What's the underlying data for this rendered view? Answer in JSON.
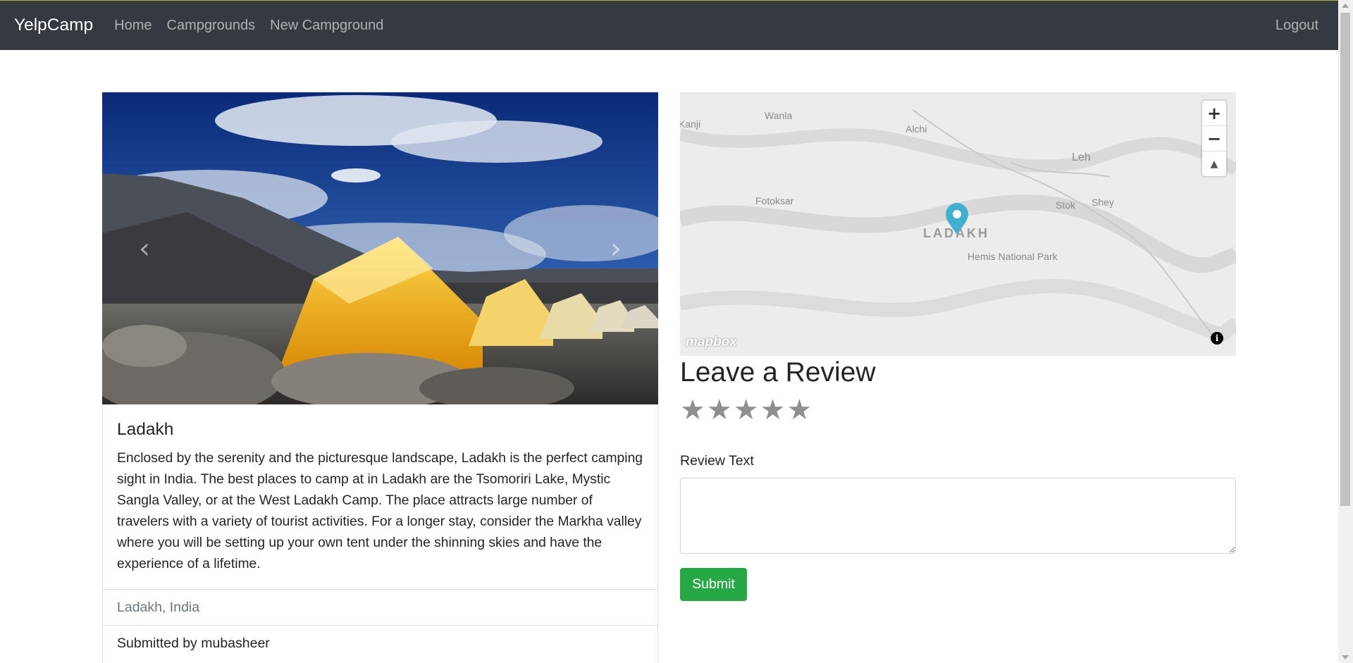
{
  "nav": {
    "brand": "YelpCamp",
    "links": [
      "Home",
      "Campgrounds",
      "New Campground"
    ],
    "logout": "Logout"
  },
  "campground": {
    "title": "Ladakh",
    "description": "Enclosed by the serenity and the picturesque landscape, Ladakh is the perfect camping sight in India. The best places to camp at in Ladakh are the Tsomoriri Lake, Mystic Sangla Valley, or at the West Ladakh Camp. The place attracts large number of travelers with a variety of tourist activities. For a longer stay, consider the Markha valley where you will be setting up your own tent under the shinning skies and have the experience of a lifetime.",
    "location": "Ladakh, India",
    "submitted_by": "Submitted by mubasheer"
  },
  "carousel": {
    "prev_icon": "‹",
    "next_icon": "›"
  },
  "map": {
    "labels": [
      "Wanla",
      "Kanji",
      "Alchi",
      "Leh",
      "Fotoksar",
      "Stok",
      "Shey",
      "Hemis National Park"
    ],
    "region": "LADAKH",
    "zoom_in": "+",
    "zoom_out": "−",
    "compass": "▲",
    "logo": "mapbox",
    "info": "i"
  },
  "review": {
    "title": "Leave a Review",
    "stars": [
      "★",
      "★",
      "★",
      "★",
      "★"
    ],
    "text_label": "Review Text",
    "text_value": "",
    "submit": "Submit"
  },
  "colors": {
    "navbar": "#343a40",
    "submit": "#28a745",
    "marker": "#3fb1ce"
  }
}
